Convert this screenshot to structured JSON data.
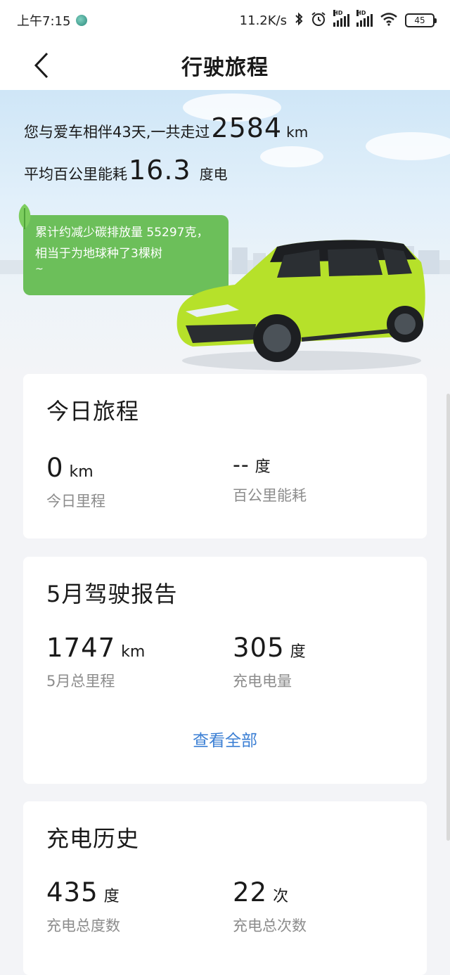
{
  "status_bar": {
    "time": "上午7:15",
    "net_speed": "11.2K/s",
    "battery": "45",
    "icons": [
      "app-notification-icon",
      "bluetooth-icon",
      "alarm-icon",
      "signal-hd-icon",
      "signal-hd-icon",
      "wifi-icon",
      "battery-icon"
    ]
  },
  "header": {
    "title": "行驶旅程",
    "back_icon": "chevron-left-icon"
  },
  "summary": {
    "line1_prefix": "您与爱车相伴43天,一共走过",
    "total_km": "2584",
    "total_km_unit": "km",
    "line2_prefix": "平均百公里能耗",
    "avg_energy": "16.3",
    "avg_energy_unit": "度电",
    "carbon_text": "累计约减少碳排放量 55297克，相当于为地球种了3棵树",
    "carbon_tail": "~"
  },
  "today": {
    "title": "今日旅程",
    "mileage_value": "0",
    "mileage_unit": "km",
    "mileage_label": "今日里程",
    "energy_value": "--",
    "energy_unit": "度",
    "energy_label": "百公里能耗"
  },
  "monthly": {
    "title": "5月驾驶报告",
    "mileage_value": "1747",
    "mileage_unit": "km",
    "mileage_label": "5月总里程",
    "charge_value": "305",
    "charge_unit": "度",
    "charge_label": "充电电量",
    "view_all": "查看全部"
  },
  "charging": {
    "title": "充电历史",
    "total_kwh_value": "435",
    "total_kwh_unit": "度",
    "total_kwh_label": "充电总度数",
    "total_count_value": "22",
    "total_count_unit": "次",
    "total_count_label": "充电总次数"
  },
  "colors": {
    "accent_link": "#3b7fd4",
    "bubble_green": "#6cbf5a",
    "car_body": "#b6e12a",
    "background": "#f3f4f7"
  }
}
